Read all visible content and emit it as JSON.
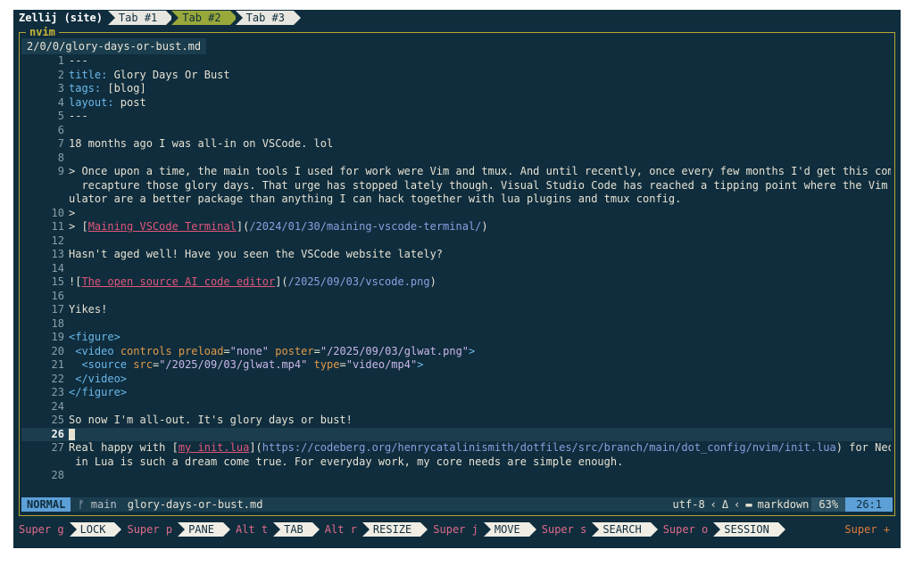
{
  "tabbar": {
    "session": "Zellij (site)",
    "tabs": [
      {
        "label": "Tab #1",
        "active": false
      },
      {
        "label": "Tab #2",
        "active": true
      },
      {
        "label": "Tab #3",
        "active": false
      }
    ]
  },
  "pane": {
    "title": "nvim",
    "file_tab": "2/0/0/glory-days-or-bust.md"
  },
  "lines": [
    {
      "n": "1",
      "t": "---"
    },
    {
      "n": "2",
      "k": "title:",
      "t": " Glory Days Or Bust"
    },
    {
      "n": "3",
      "k": "tags:",
      "t": " [blog]"
    },
    {
      "n": "4",
      "k": "layout:",
      "t": " post"
    },
    {
      "n": "5",
      "t": "---"
    },
    {
      "n": "6",
      "t": ""
    },
    {
      "n": "7",
      "t": "18 months ago I was all-in on VSCode. lol"
    },
    {
      "n": "8",
      "t": ""
    },
    {
      "n": "9",
      "t": "> Once upon a time, the main tools I used for work were Vim and tmux. And until recently, once every few months I'd get this compulsive urge to try to"
    },
    {
      "n": "",
      "t": "  recapture those glory days. That urge has stopped lately though. Visual Studio Code has reached a tipping point where the Vim support and terminal em"
    },
    {
      "n": "",
      "t": "ulator are a better package than anything I can hack together with lua plugins and tmux config."
    },
    {
      "n": "10",
      "t": ">"
    },
    {
      "n": "11",
      "pre": "> [",
      "link": "Maining VSCode Terminal",
      "mid": "](",
      "url": "/2024/01/30/maining-vscode-terminal/",
      "post": ")"
    },
    {
      "n": "12",
      "t": ""
    },
    {
      "n": "13",
      "t": "Hasn't aged well! Have you seen the VSCode website lately?"
    },
    {
      "n": "14",
      "t": ""
    },
    {
      "n": "15",
      "pre": "![",
      "link": "The open source AI code editor",
      "mid": "](",
      "url": "/2025/09/03/vscode.png",
      "post": ")"
    },
    {
      "n": "16",
      "t": ""
    },
    {
      "n": "17",
      "t": "Yikes!"
    },
    {
      "n": "18",
      "t": ""
    },
    {
      "n": "19",
      "tag": "<figure>"
    },
    {
      "n": "20",
      "indent": " ",
      "tag": "<video",
      "attrs": [
        [
          "controls",
          ""
        ],
        [
          "preload",
          "\"none\""
        ],
        [
          "poster",
          "\"/2025/09/03/glwat.png\""
        ]
      ],
      "close": ">"
    },
    {
      "n": "21",
      "indent": "  ",
      "tag": "<source",
      "attrs": [
        [
          "src",
          "\"/2025/09/03/glwat.mp4\""
        ],
        [
          "type",
          "\"video/mp4\""
        ]
      ],
      "close": ">"
    },
    {
      "n": "22",
      "indent": " ",
      "tag": "</video>"
    },
    {
      "n": "23",
      "tag": "</figure>"
    },
    {
      "n": "24",
      "t": ""
    },
    {
      "n": "25",
      "t": "So now I'm all-out. It's glory days or bust!"
    },
    {
      "n": "26",
      "t": "",
      "current": true
    },
    {
      "n": "27",
      "pre": "Real happy with [",
      "link": "my init.lua",
      "mid": "](",
      "url": "https://codeberg.org/henrycatalinismith/dotfiles/src/branch/main/dot_config/nvim/init.lua",
      "post": ") for Neovim. Doing Vim config"
    },
    {
      "n": "",
      "t": " in Lua is such a dream come true. For everyday work, my core needs are simple enough."
    },
    {
      "n": "28",
      "t": ""
    }
  ],
  "statusline": {
    "mode": "NORMAL",
    "branch": "main",
    "filename": "glory-days-or-bust.md",
    "encoding": "utf-8",
    "filetype": "markdown",
    "percent": "63%",
    "position": "26:1"
  },
  "keybar": {
    "items": [
      {
        "mod": "Super g",
        "label": "LOCK"
      },
      {
        "mod": "Super p",
        "label": "PANE"
      },
      {
        "mod": "Alt t",
        "label": "TAB"
      },
      {
        "mod": "Alt r",
        "label": "RESIZE"
      },
      {
        "mod": "Super j",
        "label": "MOVE"
      },
      {
        "mod": "Super s",
        "label": "SEARCH"
      },
      {
        "mod": "Super o",
        "label": "SESSION"
      }
    ],
    "right": "Super +"
  },
  "colors": {
    "background": "#0f2d3d",
    "active_tab": "#98a83a",
    "pane_border": "#b8a533",
    "mode_bg": "#5da0d8",
    "link": "#e0567a",
    "url": "#8b9fe0"
  }
}
